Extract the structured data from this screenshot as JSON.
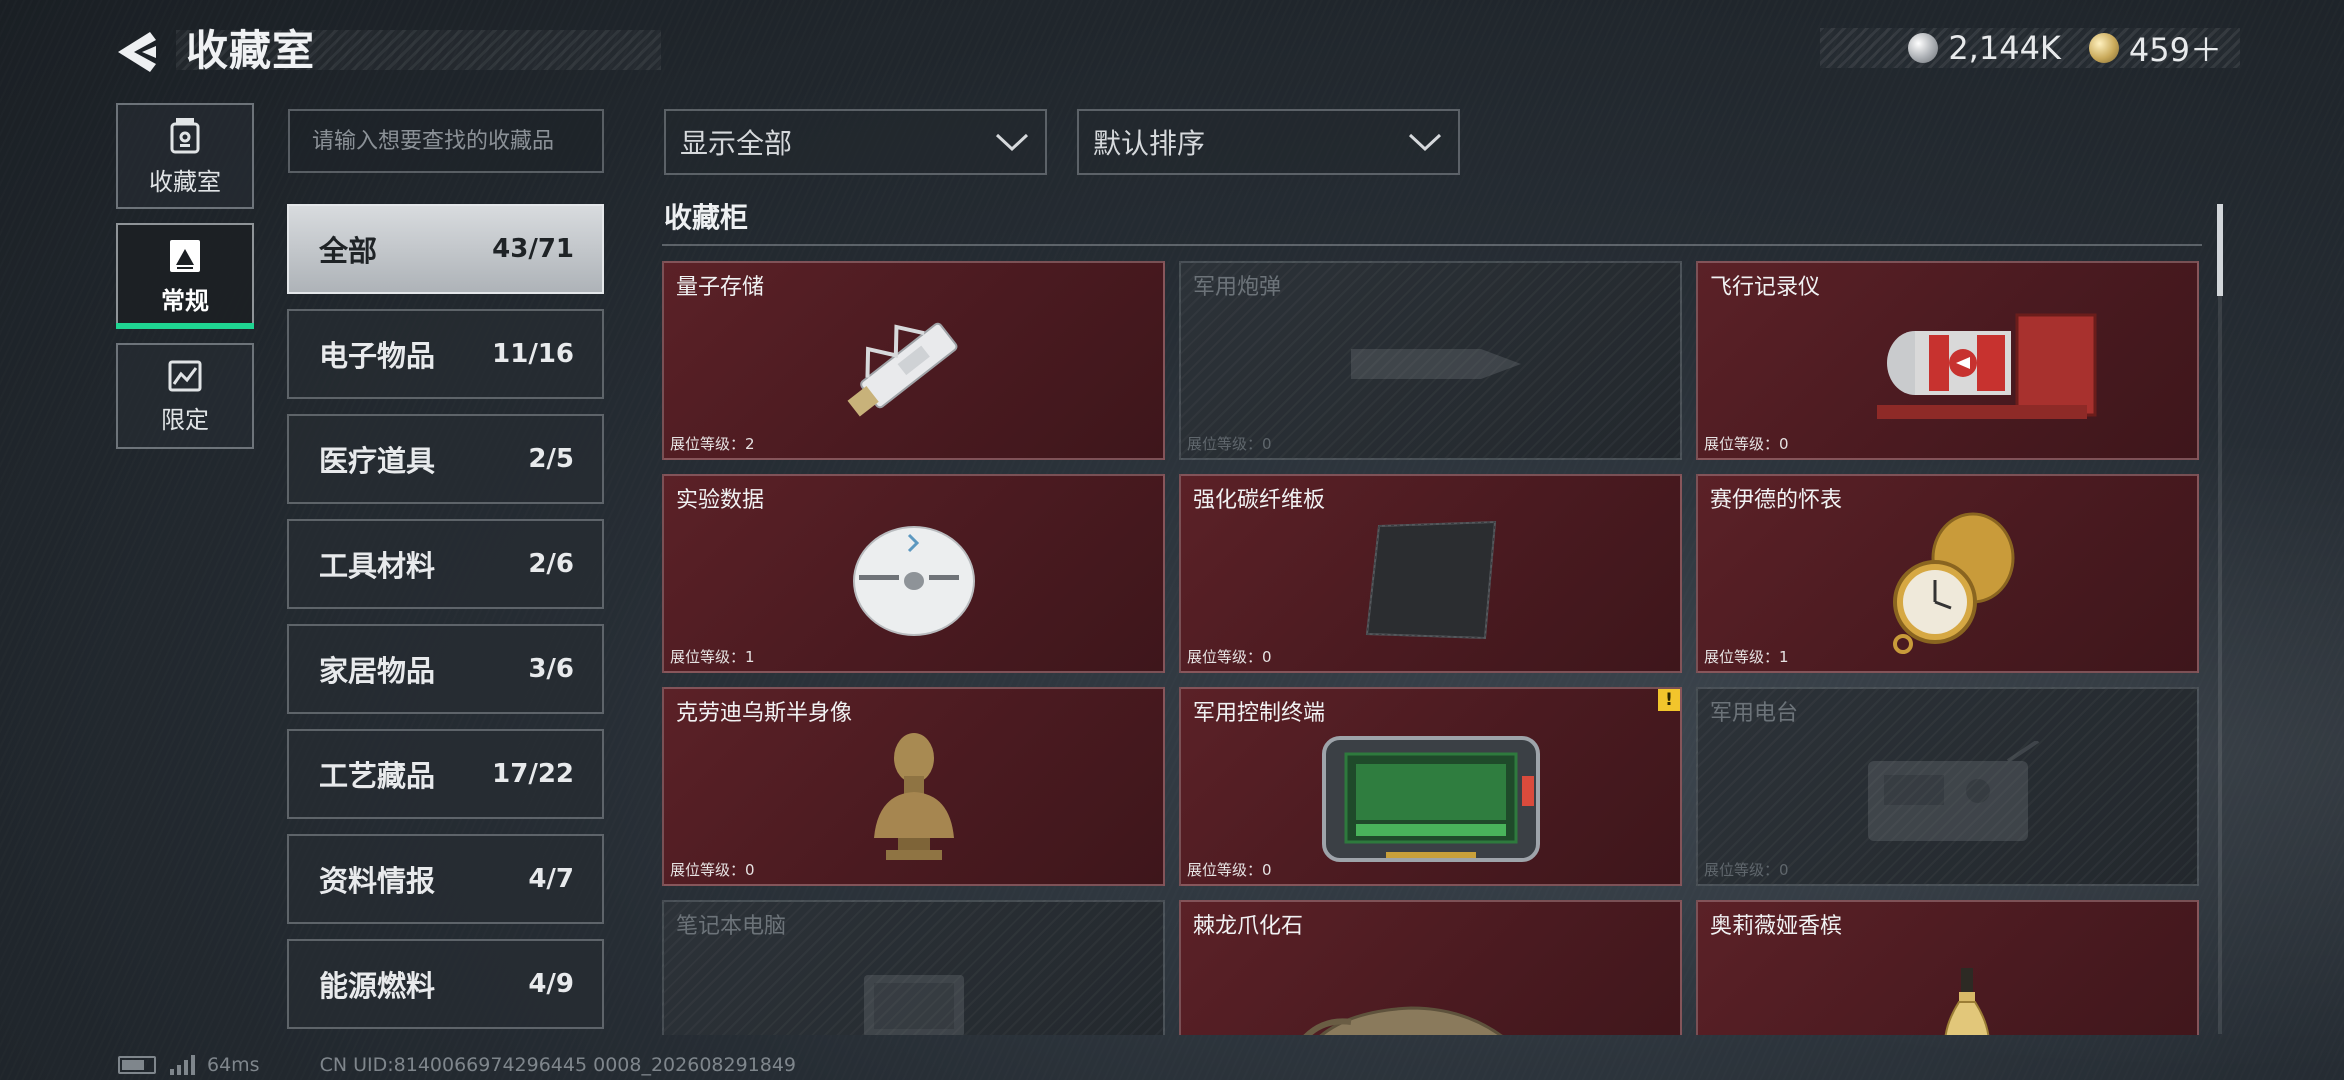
{
  "header": {
    "title": "收藏室",
    "currencies": [
      {
        "icon": "silver-coin-icon",
        "value": "2,144K"
      },
      {
        "icon": "gold-coin-icon",
        "value": "459＋"
      }
    ]
  },
  "rail": {
    "items": [
      {
        "label": "收藏室",
        "icon": "collection-room-icon"
      },
      {
        "label": "常规",
        "icon": "regular-icon",
        "active": true
      },
      {
        "label": "限定",
        "icon": "limited-icon"
      }
    ]
  },
  "search": {
    "placeholder": "请输入想要查找的收藏品"
  },
  "categories": [
    {
      "name": "全部",
      "count": "43/71"
    },
    {
      "name": "电子物品",
      "count": "11/16"
    },
    {
      "name": "医疗道具",
      "count": "2/5"
    },
    {
      "name": "工具材料",
      "count": "2/6"
    },
    {
      "name": "家居物品",
      "count": "3/6"
    },
    {
      "name": "工艺藏品",
      "count": "17/22"
    },
    {
      "name": "资料情报",
      "count": "4/7"
    },
    {
      "name": "能源燃料",
      "count": "4/9"
    }
  ],
  "filters": {
    "filter_label": "显示全部",
    "sort_label": "默认排序"
  },
  "cabinet": {
    "title": "收藏柜",
    "level_prefix": "展位等级：",
    "items": [
      {
        "name": "量子存储",
        "level": "2",
        "icon": "usb-drive-icon"
      },
      {
        "name": "军用炮弹",
        "level": "0",
        "icon": "artillery-shell-icon",
        "locked": true
      },
      {
        "name": "飞行记录仪",
        "level": "0",
        "icon": "flight-recorder-icon"
      },
      {
        "name": "实验数据",
        "level": "1",
        "icon": "disc-icon"
      },
      {
        "name": "强化碳纤维板",
        "level": "0",
        "icon": "carbon-plate-icon"
      },
      {
        "name": "赛伊德的怀表",
        "level": "1",
        "icon": "pocket-watch-icon"
      },
      {
        "name": "克劳迪乌斯半身像",
        "level": "0",
        "icon": "bust-icon"
      },
      {
        "name": "军用控制终端",
        "level": "0",
        "icon": "control-terminal-icon",
        "badge": "!"
      },
      {
        "name": "军用电台",
        "level": "0",
        "icon": "radio-icon",
        "locked": true
      },
      {
        "name": "笔记本电脑",
        "level": "",
        "icon": "laptop-icon",
        "locked": true
      },
      {
        "name": "棘龙爪化石",
        "level": "",
        "icon": "claw-fossil-icon"
      },
      {
        "name": "奥莉薇娅香槟",
        "level": "",
        "icon": "champagne-icon"
      }
    ]
  },
  "footer": {
    "ping": "64ms",
    "uid": "CN UID:8140066974296445 0008_202608291849"
  }
}
